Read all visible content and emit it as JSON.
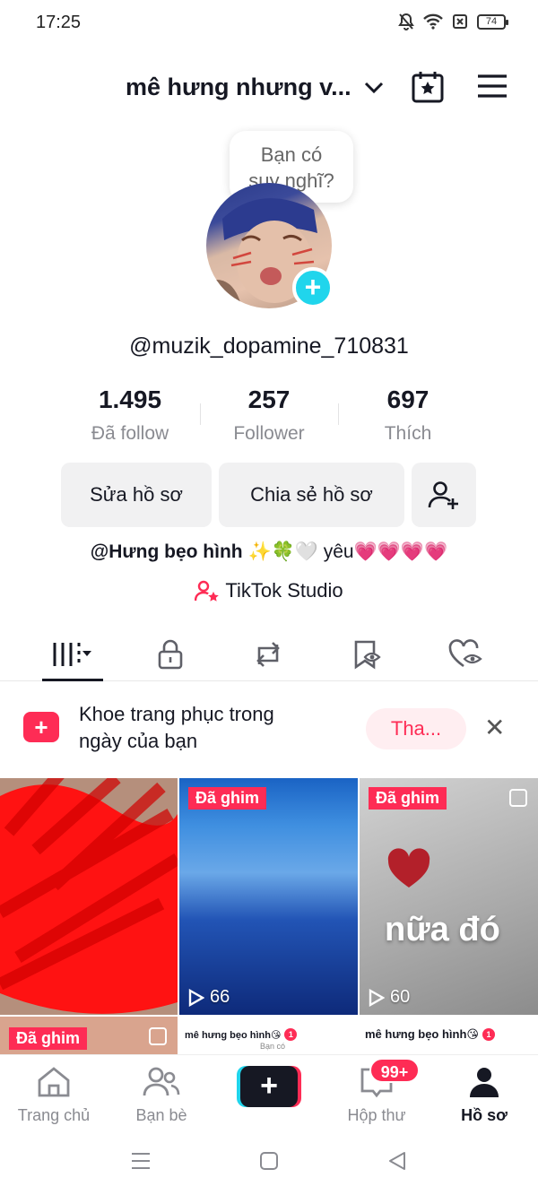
{
  "status_bar": {
    "time": "17:25",
    "battery": "74"
  },
  "header": {
    "profile_name": "mê hưng nhưng v..."
  },
  "bubble": {
    "text_line1": "Bạn có",
    "text_line2": "suy nghĩ?"
  },
  "profile": {
    "username": "@muzik_dopamine_710831"
  },
  "stats": [
    {
      "value": "1.495",
      "label": "Đã follow"
    },
    {
      "value": "257",
      "label": "Follower"
    },
    {
      "value": "697",
      "label": "Thích"
    }
  ],
  "buttons": {
    "edit_profile": "Sửa hồ sơ",
    "share_profile": "Chia sẻ hồ sơ"
  },
  "bio": {
    "name": "@Hưng bẹo hình",
    "emojis": "✨🍀🤍",
    "word": "yêu",
    "hearts": "💗💗💗💗"
  },
  "studio": {
    "label": "TikTok Studio"
  },
  "promo": {
    "line1": "Khoe trang phục trong",
    "line2": "ngày của bạn",
    "button": "Tha..."
  },
  "grid": {
    "pinned_label": "Đã ghim",
    "videos": [
      {
        "views": "66"
      },
      {
        "views": "60",
        "overlay_text": "nữa đó"
      }
    ],
    "mini_header_text": "mê hưng bẹo hình😘",
    "mini_badge": "1",
    "mini_bubble_text": "Bạn có"
  },
  "bottom_nav": {
    "home": "Trang chủ",
    "friends": "Bạn bè",
    "inbox": "Hộp thư",
    "profile": "Hồ sơ",
    "inbox_badge": "99+"
  },
  "colors": {
    "accent": "#fe2c55",
    "cyan": "#20d5ec",
    "text": "#161823",
    "muted": "#8a8b91"
  }
}
